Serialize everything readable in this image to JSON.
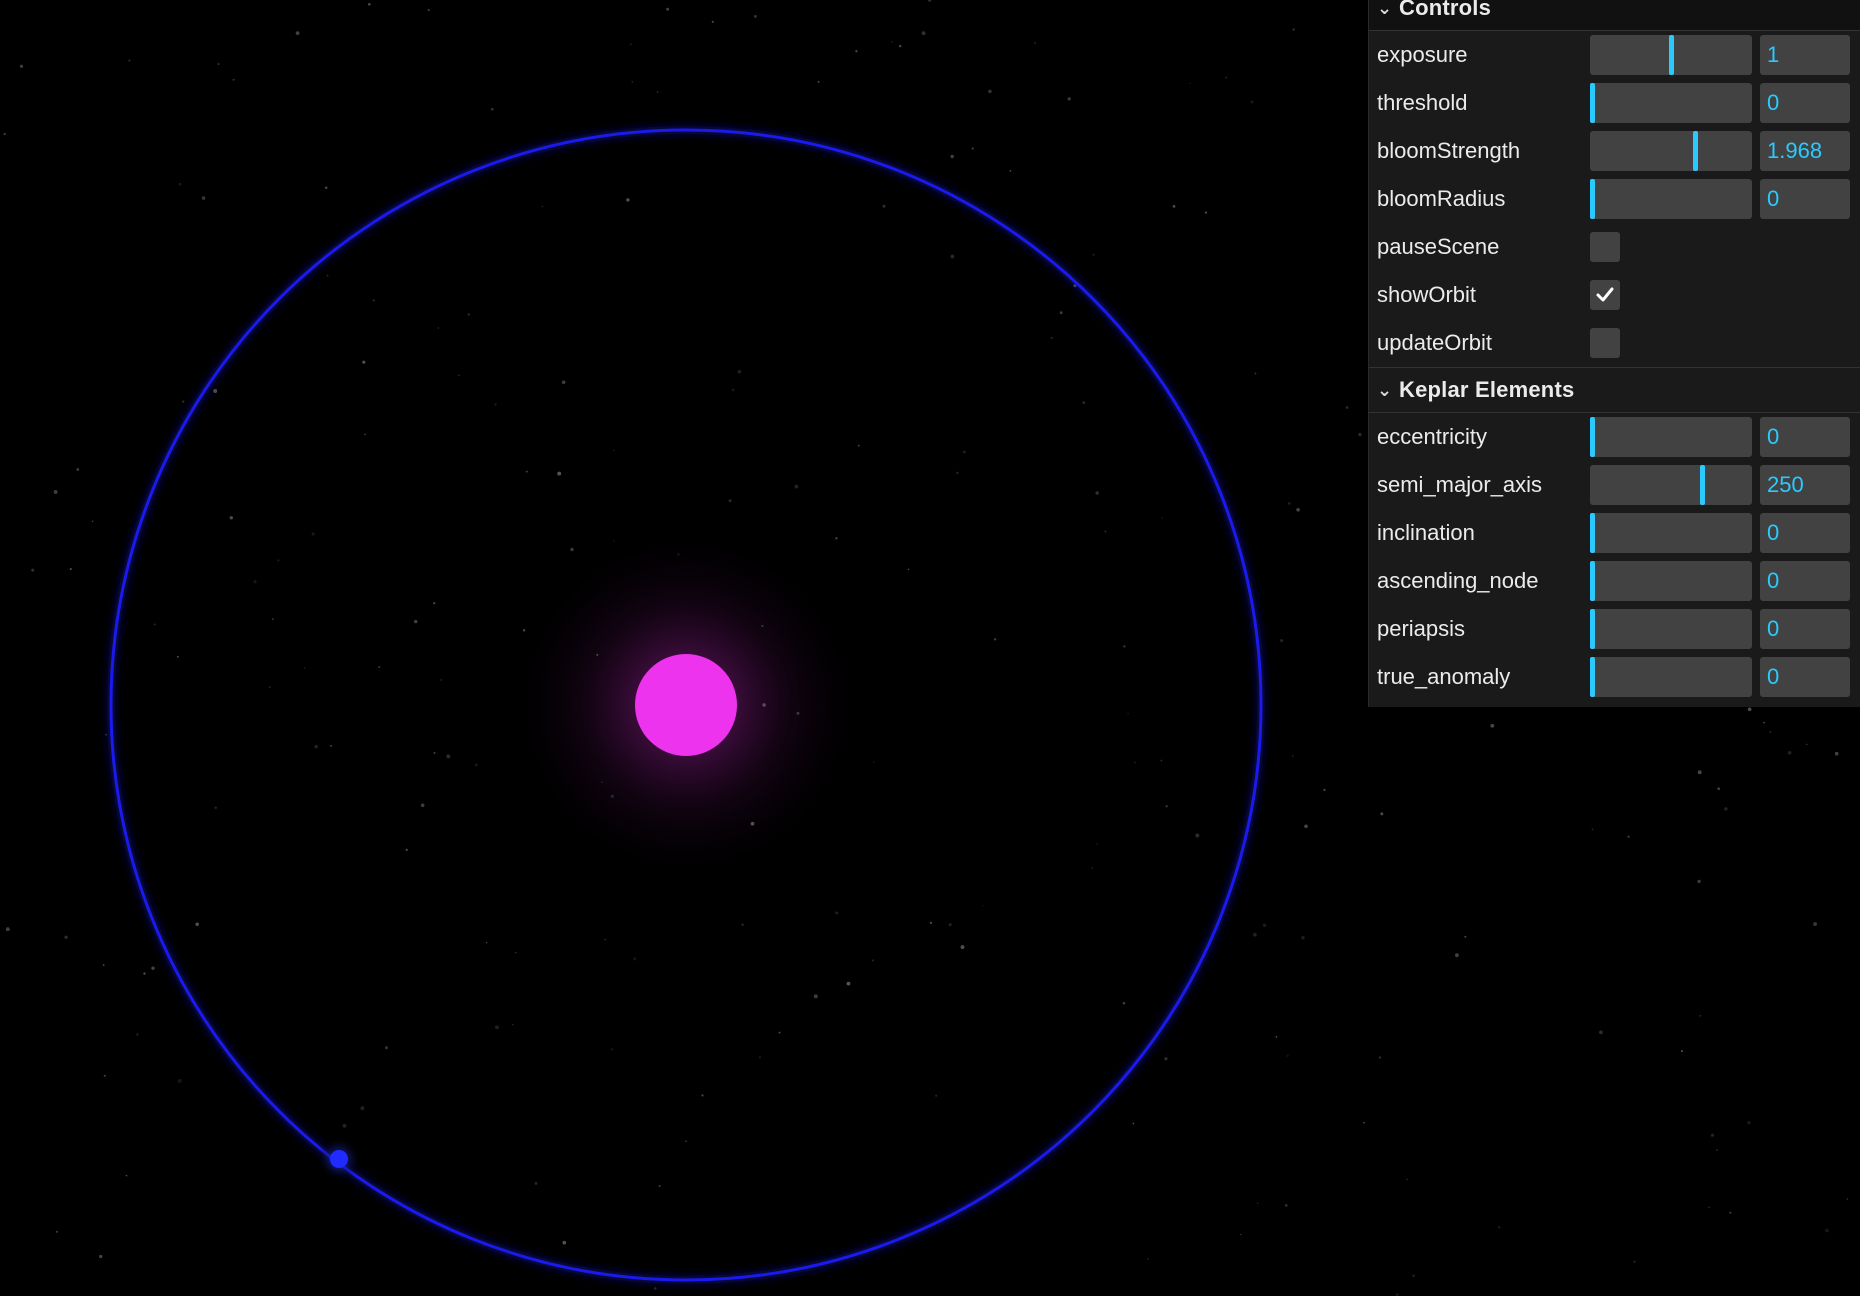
{
  "controls_folder": {
    "title": "Controls",
    "rows": [
      {
        "label": "exposure",
        "value": "1",
        "fraction": 0.5
      },
      {
        "label": "threshold",
        "value": "0",
        "fraction": 0.0
      },
      {
        "label": "bloomStrength",
        "value": "1.968",
        "fraction": 0.656
      },
      {
        "label": "bloomRadius",
        "value": "0",
        "fraction": 0.0
      }
    ],
    "toggles": [
      {
        "label": "pauseScene",
        "checked": false
      },
      {
        "label": "showOrbit",
        "checked": true
      },
      {
        "label": "updateOrbit",
        "checked": false
      }
    ]
  },
  "keplar_folder": {
    "title": "Keplar Elements",
    "rows": [
      {
        "label": "eccentricity",
        "value": "0",
        "fraction": 0.0
      },
      {
        "label": "semi_major_axis",
        "value": "250",
        "fraction": 0.7
      },
      {
        "label": "inclination",
        "value": "0",
        "fraction": 0.0
      },
      {
        "label": "ascending_node",
        "value": "0",
        "fraction": 0.0
      },
      {
        "label": "periapsis",
        "value": "0",
        "fraction": 0.0
      },
      {
        "label": "true_anomaly",
        "value": "0",
        "fraction": 0.0
      }
    ]
  },
  "icons": {
    "folder_toggle": "chevron-down-icon",
    "check": "checkmark-icon"
  },
  "colors": {
    "background": "#000000",
    "sun": "#ee33ee",
    "orbit": "#1a1aff",
    "planet": "#1f2bff",
    "accent": "#2cc9ff",
    "panel": "#1a1a1a",
    "field": "#424242"
  }
}
